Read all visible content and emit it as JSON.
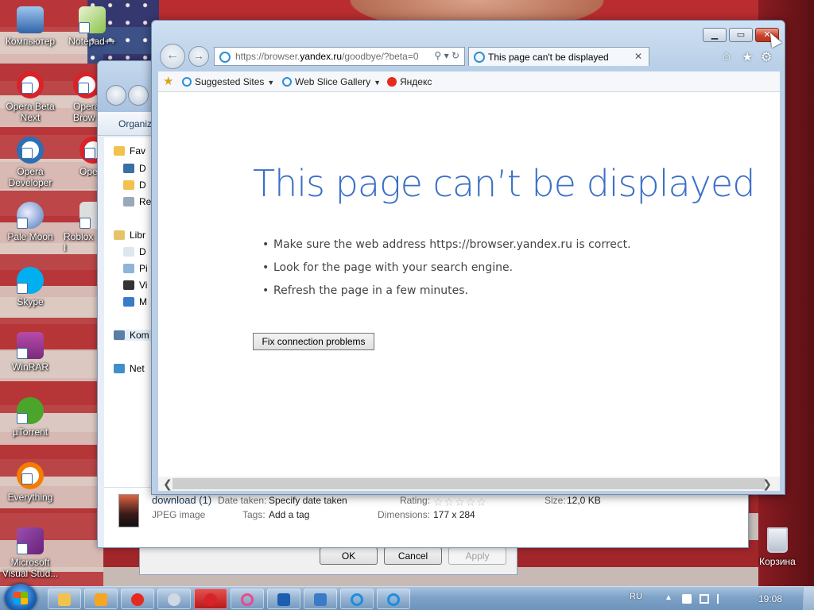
{
  "desktop": {
    "icons": [
      {
        "label": "Компьютер",
        "icon": "computer-icon",
        "color": "#3a6ea5"
      },
      {
        "label": "Notepad++",
        "icon": "notepadpp-icon",
        "color": "#8bc34a"
      },
      {
        "label": "Opera Beta Next",
        "icon": "opera-beta-icon",
        "color": "#d8232a"
      },
      {
        "label": "Opera Browser",
        "label_visible": "Opera Brow",
        "icon": "opera-icon",
        "color": "#d8232a"
      },
      {
        "label": "Opera Developer",
        "icon": "opera-dev-icon",
        "color": "#2b6fb6"
      },
      {
        "label": "Ope",
        "icon": "opera-icon-2",
        "color": "#d8232a"
      },
      {
        "label": "Pale Moon",
        "icon": "pale-moon-icon",
        "color": "#4a78b8"
      },
      {
        "label": "Roblox I",
        "icon": "roblox-icon",
        "color": "#aaaaaa"
      },
      {
        "label": "Skype",
        "icon": "skype-icon",
        "color": "#00aff0"
      },
      {
        "label": "WinRAR",
        "icon": "winrar-icon",
        "color": "#7a2b7d"
      },
      {
        "label": "µTorrent",
        "icon": "utorrent-icon",
        "color": "#4aa52a"
      },
      {
        "label": "Everything",
        "icon": "everything-icon",
        "color": "#f57c00"
      },
      {
        "label": "Microsoft Visual Stud...",
        "icon": "visual-studio-icon",
        "color": "#68217a"
      }
    ],
    "recycle_bin": "Корзина"
  },
  "taskbar": {
    "language": "RU",
    "clock": "19:08",
    "buttons": [
      {
        "icon": "explorer-icon",
        "color": "#f2c14e"
      },
      {
        "icon": "media-player-icon",
        "color": "#f5a623"
      },
      {
        "icon": "yandex-browser-icon",
        "color": "#e62b1e"
      },
      {
        "icon": "pale-moon-taskbar-icon",
        "color": "#cfd8e3"
      },
      {
        "icon": "opera-taskbar-icon",
        "color": "#d8232a"
      },
      {
        "icon": "opera-dev-taskbar-icon",
        "color": "#e94b8a"
      },
      {
        "icon": "outlook-icon",
        "color": "#1c5eb0"
      },
      {
        "icon": "remote-desktop-icon",
        "color": "#3a7bc8"
      },
      {
        "icon": "ie-taskbar-icon",
        "color": "#1a8fe0"
      },
      {
        "icon": "ie-taskbar-icon-2",
        "color": "#1a8fe0"
      }
    ]
  },
  "explorer": {
    "organize_label": "Organiz",
    "nav_items": [
      "Fav",
      "D",
      "D",
      "Re",
      "Libr",
      "D",
      "Pi",
      "Vi",
      "M",
      "Kom",
      "Net"
    ],
    "details": {
      "filename": "download (1)",
      "filetype": "JPEG image",
      "date_taken_label": "Date taken:",
      "date_taken_value": "Specify date taken",
      "tags_label": "Tags:",
      "tags_value": "Add a tag",
      "rating_label": "Rating:",
      "dimensions_label": "Dimensions:",
      "dimensions_value": "177 x 284",
      "size_label": "Size:",
      "size_value": "12,0 KB"
    }
  },
  "dialog": {
    "ok": "OK",
    "cancel": "Cancel",
    "apply": "Apply"
  },
  "ie": {
    "address": {
      "prefix": "https://browser.",
      "domain": "yandex.ru",
      "suffix": "/goodbye/?beta=0"
    },
    "tab_title": "This page can't be displayed",
    "favorites_bar": {
      "suggested": "Suggested Sites",
      "web_slice": "Web Slice Gallery",
      "yandex": "Яндекс"
    },
    "error": {
      "title": "This page can’t be displayed",
      "tips": [
        "Make sure the web address https://browser.yandex.ru is correct.",
        "Look for the page with your search engine.",
        "Refresh the page in a few minutes."
      ],
      "fix_button": "Fix connection problems"
    }
  },
  "colors": {
    "ie_blue": "#3b6fc7",
    "taskbar": "#7ea2c8"
  }
}
